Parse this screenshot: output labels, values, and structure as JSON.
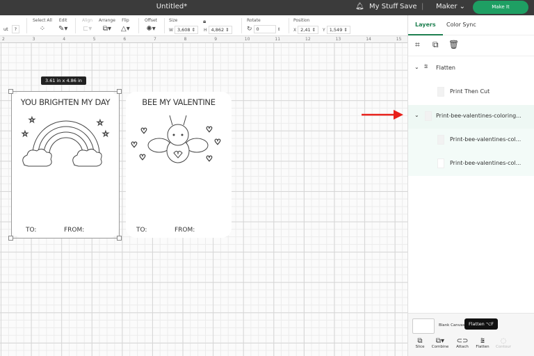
{
  "topbar": {
    "title": "Untitled*",
    "my_stuff": "My Stuff",
    "save": "Save",
    "machine": "Maker",
    "make_it": "Make It"
  },
  "toolbar": {
    "cut_label": "ut",
    "help": "?",
    "select_all": "Select All",
    "edit": "Edit",
    "align": "Align",
    "arrange": "Arrange",
    "flip": "Flip",
    "offset": "Offset",
    "size": "Size",
    "w_label": "W",
    "w_value": "3,608",
    "h_label": "H",
    "h_value": "4,862",
    "rotate": "Rotate",
    "rotate_value": "0",
    "position": "Position",
    "x_label": "X",
    "x_value": "2,41",
    "y_label": "Y",
    "y_value": "1,549"
  },
  "ruler": [
    "2",
    "3",
    "4",
    "5",
    "6",
    "7",
    "8",
    "9",
    "10",
    "11",
    "12",
    "13",
    "14",
    "15"
  ],
  "canvas": {
    "dimension_tip": "3.61  in x 4.86  in",
    "card1": {
      "title": "YOU BRIGHTEN MY DAY",
      "to": "TO:",
      "from": "FROM:"
    },
    "card2": {
      "title": "BEE MY VALENTINE",
      "to": "TO:",
      "from": "FROM:"
    }
  },
  "panel": {
    "tabs": [
      {
        "label": "Layers",
        "active": true
      },
      {
        "label": "Color Sync",
        "active": false
      }
    ],
    "layers": [
      {
        "label": "Flatten",
        "icon": "flatten-icon",
        "expanded": true
      },
      {
        "label": "Print Then Cut",
        "indent": 1
      },
      {
        "label": "Print-bee-valentines-coloring...",
        "expanded": true,
        "selected": true
      },
      {
        "label": "Print-bee-valentines-col...",
        "indent": 1
      },
      {
        "label": "Print-bee-valentines-col...",
        "indent": 1
      }
    ],
    "blank_canvas": "Blank Canvas",
    "actions": [
      {
        "label": "Slice"
      },
      {
        "label": "Combine"
      },
      {
        "label": "Attach"
      },
      {
        "label": "Flatten"
      },
      {
        "label": "Contour",
        "disabled": true
      }
    ],
    "tooltip": "Flatten ⌥F"
  },
  "colors": {
    "accent": "#1e9f63",
    "annotation_arrow": "#e8201a",
    "selected_layer": "#eef8f4"
  }
}
